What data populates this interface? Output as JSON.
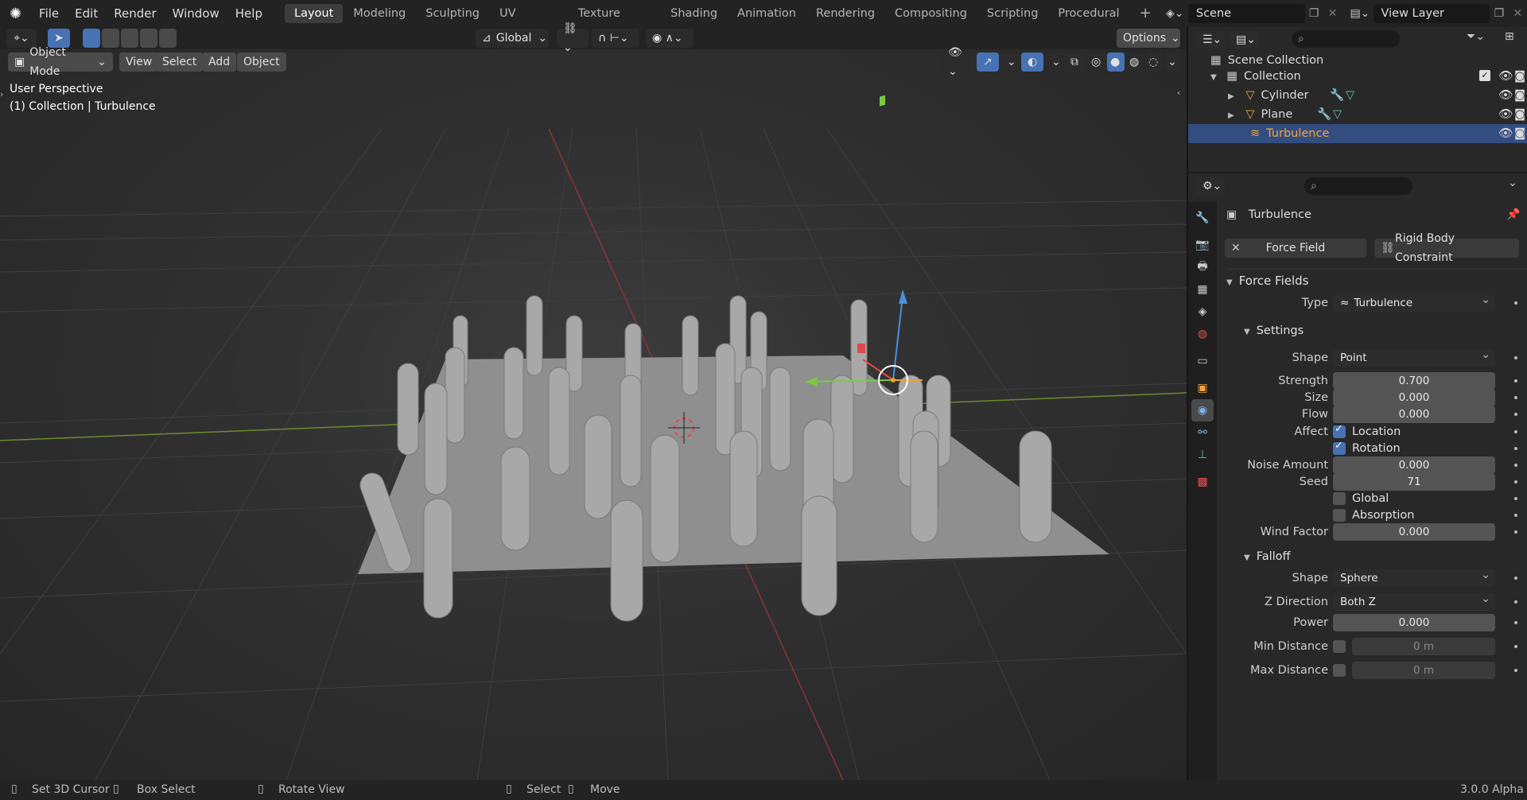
{
  "menubar": {
    "items": [
      "File",
      "Edit",
      "Render",
      "Window",
      "Help"
    ],
    "workspaces": [
      "Layout",
      "Modeling",
      "Sculpting",
      "UV Editing",
      "Texture Paint",
      "Shading",
      "Animation",
      "Rendering",
      "Compositing",
      "Scripting",
      "Procedural"
    ],
    "active_workspace": "Layout",
    "add_tab": "+",
    "scene": "Scene",
    "view_layer": "View Layer"
  },
  "toolbar": {
    "transform_orientation": "Global",
    "options": "Options"
  },
  "viewport_header": {
    "mode": "Object Mode",
    "menus": [
      "View",
      "Select",
      "Add",
      "Object"
    ]
  },
  "viewport": {
    "perspective": "User Perspective",
    "collection_info": "(1) Collection | Turbulence"
  },
  "outliner": {
    "root": "Scene Collection",
    "collection": "Collection",
    "objects": [
      "Cylinder",
      "Plane",
      "Turbulence"
    ],
    "selected": "Turbulence"
  },
  "properties": {
    "object_name": "Turbulence",
    "physics_buttons": [
      "Force Field",
      "Rigid Body Constraint"
    ],
    "section_force_fields": "Force Fields",
    "type_label": "Type",
    "type_value": "Turbulence",
    "section_settings": "Settings",
    "settings": {
      "shape_label": "Shape",
      "shape_value": "Point",
      "strength_label": "Strength",
      "strength_value": "0.700",
      "size_label": "Size",
      "size_value": "0.000",
      "flow_label": "Flow",
      "flow_value": "0.000",
      "affect_label": "Affect",
      "affect_location": "Location",
      "affect_rotation": "Rotation",
      "noise_label": "Noise Amount",
      "noise_value": "0.000",
      "seed_label": "Seed",
      "seed_value": "71",
      "global_label": "Global",
      "absorption_label": "Absorption",
      "wind_label": "Wind Factor",
      "wind_value": "0.000"
    },
    "section_falloff": "Falloff",
    "falloff": {
      "shape_label": "Shape",
      "shape_value": "Sphere",
      "zdir_label": "Z Direction",
      "zdir_value": "Both Z",
      "power_label": "Power",
      "power_value": "0.000",
      "min_label": "Min Distance",
      "min_value": "0 m",
      "max_label": "Max Distance",
      "max_value": "0 m"
    }
  },
  "statusbar": {
    "set_cursor": "Set 3D Cursor",
    "box_select": "Box Select",
    "rotate_view": "Rotate View",
    "select": "Select",
    "move": "Move",
    "version": "3.0.0 Alpha"
  },
  "colors": {
    "accent_blue": "#4772b3",
    "selected_orange": "#f2a440",
    "background": "#1d1d1d"
  }
}
